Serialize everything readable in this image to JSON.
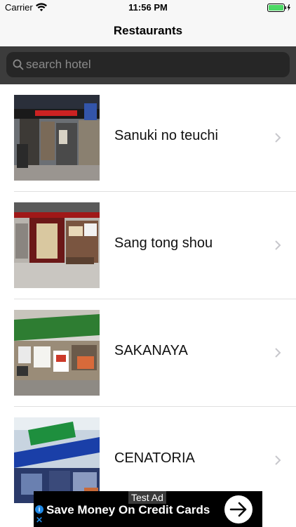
{
  "status_bar": {
    "carrier": "Carrier",
    "time": "11:56 PM",
    "wifi_icon": "wifi-icon",
    "battery_icon": "battery-icon",
    "battery_color": "#4cd964"
  },
  "nav": {
    "title": "Restaurants"
  },
  "search": {
    "placeholder": "search hotel",
    "value": "",
    "icon": "search-icon"
  },
  "restaurants": [
    {
      "name": "Sanuki no teuchi",
      "thumb": "photo-storefront-1"
    },
    {
      "name": "Sang tong shou",
      "thumb": "photo-storefront-2"
    },
    {
      "name": "SAKANAYA",
      "thumb": "photo-storefront-3"
    },
    {
      "name": "CENATORIA",
      "thumb": "photo-storefront-4"
    }
  ],
  "ad": {
    "label": "Test Ad",
    "text": "Save Money On Credit Cards",
    "info_icon": "ad-choices-icon",
    "close_icon": "close-icon",
    "arrow_icon": "arrow-right-icon"
  }
}
